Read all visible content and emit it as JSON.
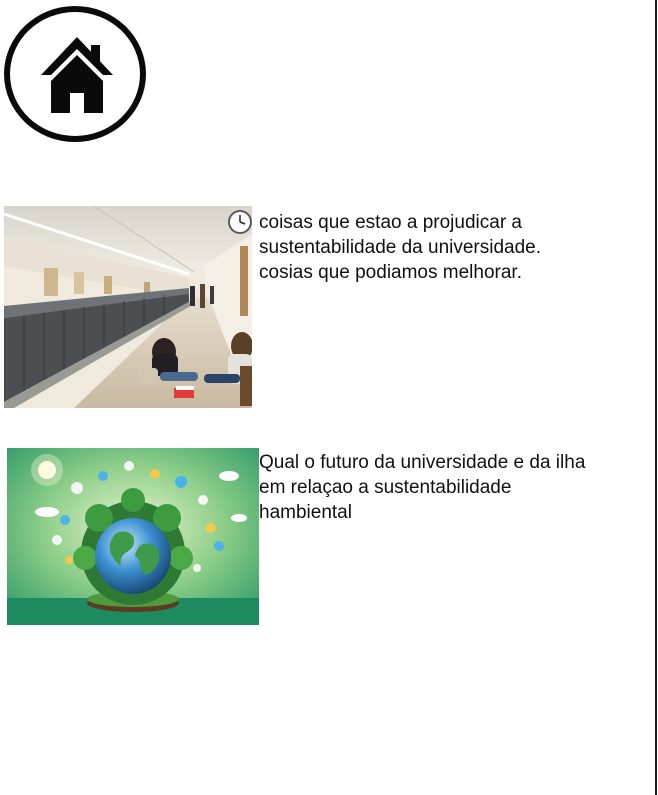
{
  "header": {
    "home_icon": "home-icon"
  },
  "cards": [
    {
      "image": "university-hallway-photo",
      "lines": [
        "coisas que estao a projudicar a",
        "sustentabilidade da universidade.",
        "cosias que podiamos melhorar."
      ]
    },
    {
      "image": "green-earth-sustainability-illustration",
      "lines": [
        "Qual o futuro da universidade e da ilha",
        "em relaçao a sustentabilidade",
        "hambiental"
      ]
    }
  ],
  "colors": {
    "border": "#0a0a0a",
    "text": "#111111",
    "background": "#ffffff"
  }
}
